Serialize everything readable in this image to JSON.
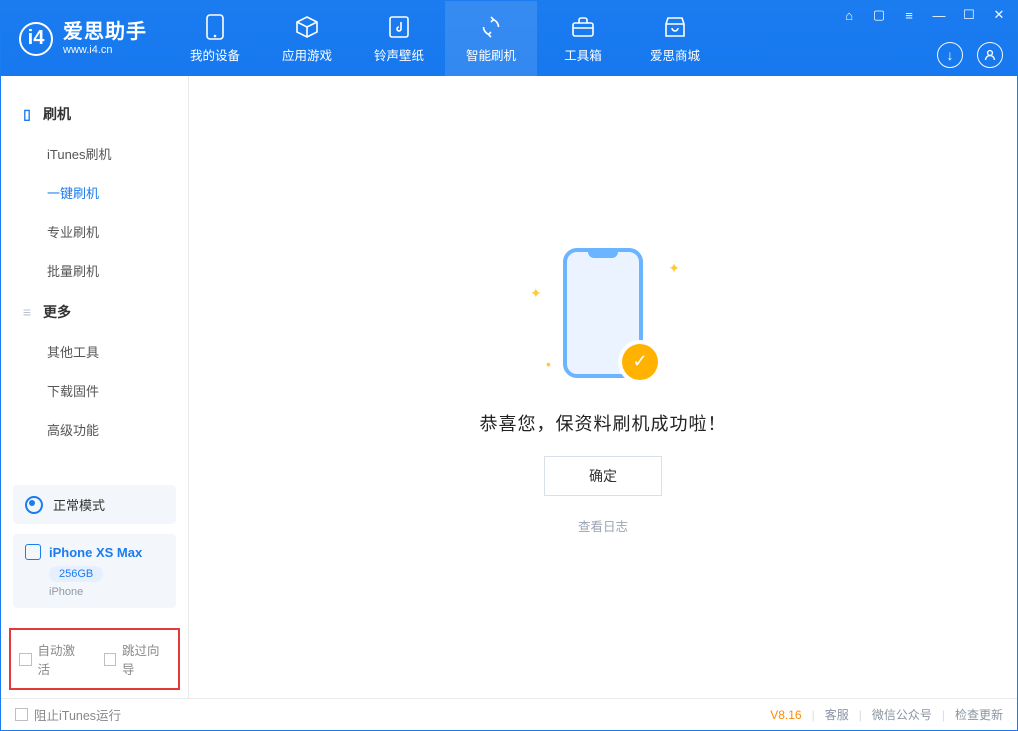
{
  "header": {
    "app_name": "爱思助手",
    "app_site": "www.i4.cn",
    "nav": [
      {
        "label": "我的设备",
        "icon": "device"
      },
      {
        "label": "应用游戏",
        "icon": "cube"
      },
      {
        "label": "铃声壁纸",
        "icon": "music"
      },
      {
        "label": "智能刷机",
        "icon": "refresh",
        "active": true
      },
      {
        "label": "工具箱",
        "icon": "toolbox"
      },
      {
        "label": "爱思商城",
        "icon": "store"
      }
    ],
    "window_icons": [
      "tshirt",
      "phone",
      "menu",
      "minimize",
      "maximize",
      "close"
    ],
    "user_icons": [
      "download",
      "profile"
    ]
  },
  "sidebar": {
    "groups": [
      {
        "title": "刷机",
        "icon": "phone-icon",
        "items": [
          {
            "label": "iTunes刷机"
          },
          {
            "label": "一键刷机",
            "active": true
          },
          {
            "label": "专业刷机"
          },
          {
            "label": "批量刷机"
          }
        ]
      },
      {
        "title": "更多",
        "icon": "list-icon",
        "items": [
          {
            "label": "其他工具"
          },
          {
            "label": "下载固件"
          },
          {
            "label": "高级功能"
          }
        ]
      }
    ],
    "mode_label": "正常模式",
    "device": {
      "name": "iPhone XS Max",
      "capacity": "256GB",
      "type": "iPhone"
    },
    "options": {
      "auto_activate": "自动激活",
      "skip_wizard": "跳过向导"
    }
  },
  "main": {
    "success_msg": "恭喜您，保资料刷机成功啦！",
    "confirm_btn": "确定",
    "view_log": "查看日志"
  },
  "footer": {
    "block_itunes": "阻止iTunes运行",
    "version": "V8.16",
    "links": [
      "客服",
      "微信公众号",
      "检查更新"
    ]
  }
}
